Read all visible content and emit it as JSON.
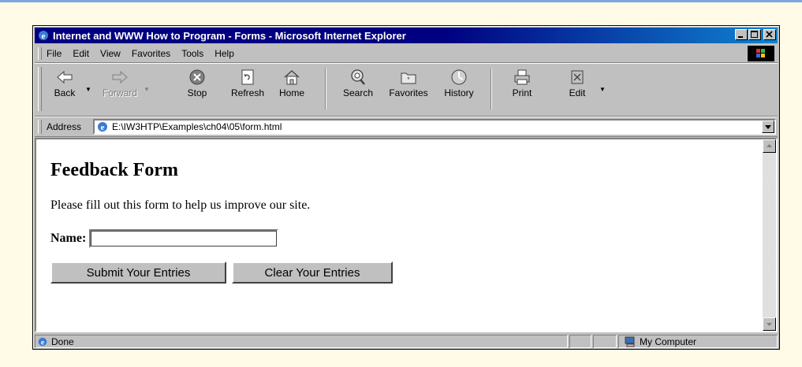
{
  "window": {
    "title": "Internet and WWW How to Program - Forms - Microsoft Internet Explorer"
  },
  "menu": {
    "items": [
      {
        "label": "File"
      },
      {
        "label": "Edit"
      },
      {
        "label": "View"
      },
      {
        "label": "Favorites"
      },
      {
        "label": "Tools"
      },
      {
        "label": "Help"
      }
    ]
  },
  "toolbar": {
    "back": "Back",
    "forward": "Forward",
    "stop": "Stop",
    "refresh": "Refresh",
    "home": "Home",
    "search": "Search",
    "favorites": "Favorites",
    "history": "History",
    "print": "Print",
    "edit": "Edit"
  },
  "address": {
    "label": "Address",
    "value": "E:\\IW3HTP\\Examples\\ch04\\05\\form.html"
  },
  "page": {
    "heading": "Feedback Form",
    "intro": "Please fill out this form to help us improve our site.",
    "name_label": "Name:",
    "name_value": "",
    "submit_label": "Submit Your Entries",
    "clear_label": "Clear Your Entries"
  },
  "status": {
    "text": "Done",
    "zone": "My Computer"
  },
  "colors": {
    "titlebar": "#000080",
    "chrome": "#c0c0c0",
    "page_background": "#fffbe6"
  }
}
